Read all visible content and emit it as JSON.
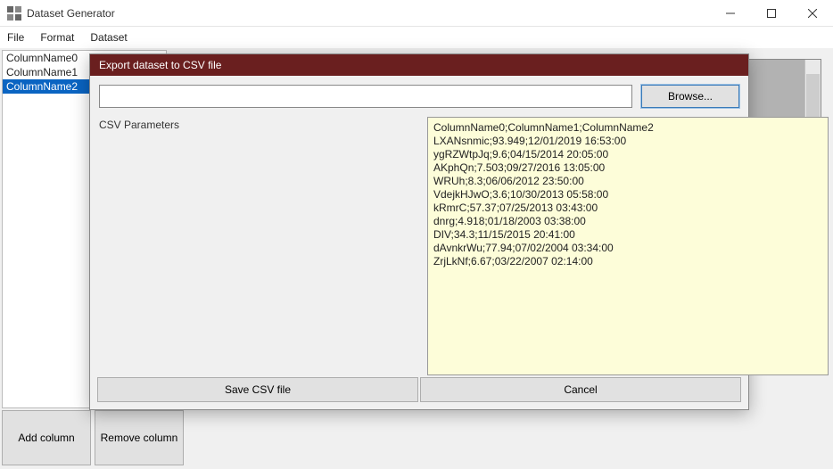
{
  "window": {
    "title": "Dataset Generator"
  },
  "menu": {
    "file": "File",
    "format": "Format",
    "dataset": "Dataset"
  },
  "columns": {
    "items": [
      {
        "label": "ColumnName0"
      },
      {
        "label": "ColumnName1"
      },
      {
        "label": "ColumnName2"
      }
    ]
  },
  "buttons": {
    "add_column": "Add column",
    "remove_column": "Remove column"
  },
  "modal": {
    "title": "Export dataset to CSV file",
    "path_value": "",
    "browse_label": "Browse...",
    "params_label": "CSV Parameters",
    "save_label": "Save CSV file",
    "cancel_label": "Cancel",
    "csv_text": "ColumnName0;ColumnName1;ColumnName2\nLXANsnmic;93.949;12/01/2019 16:53:00\nygRZWtpJq;9.6;04/15/2014 20:05:00\nAKphQn;7.503;09/27/2016 13:05:00\nWRUh;8.3;06/06/2012 23:50:00\nVdejkHJwO;3.6;10/30/2013 05:58:00\nkRmrC;57.37;07/25/2013 03:43:00\ndnrg;4.918;01/18/2003 03:38:00\nDIV;34.3;11/15/2015 20:41:00\ndAvnkrWu;77.94;07/02/2004 03:34:00\nZrjLkNf;6.67;03/22/2007 02:14:00"
  }
}
